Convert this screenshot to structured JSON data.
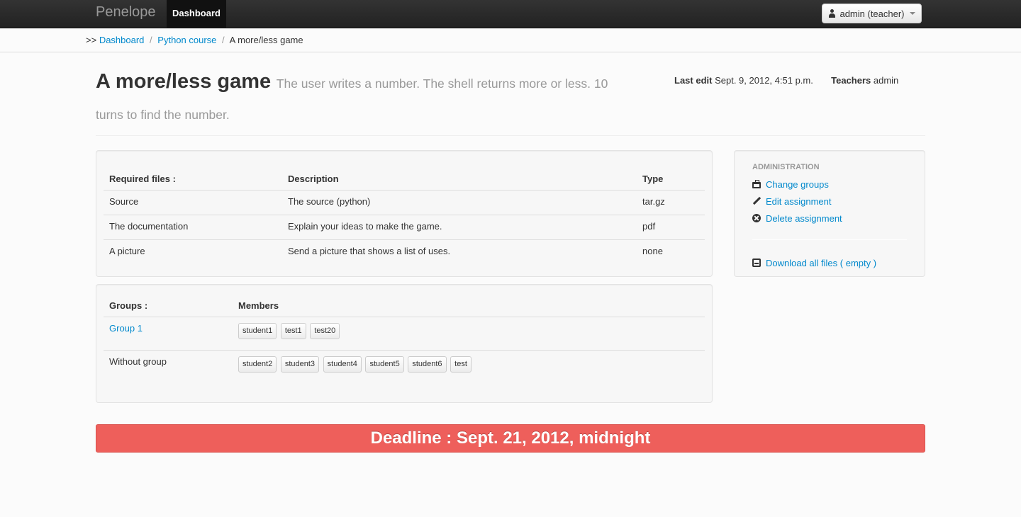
{
  "navbar": {
    "brand": "Penelope",
    "active_item": "Dashboard",
    "user_menu": "admin (teacher)"
  },
  "breadcrumb": {
    "prefix": ">>",
    "items": [
      "Dashboard",
      "Python course"
    ],
    "current": "A more/less game",
    "separator": "/"
  },
  "assignment": {
    "title": "A more/less game",
    "subtitle": "The user writes a number. The shell returns more or less. 10 turns to find the number.",
    "last_edit_label": "Last edit",
    "last_edit_value": "Sept. 9, 2012, 4:51 p.m.",
    "teachers_label": "Teachers",
    "teachers_value": "admin"
  },
  "files_table": {
    "headers": [
      "Required files :",
      "Description",
      "Type"
    ],
    "rows": [
      {
        "name": "Source",
        "description": "The source (python)",
        "type": "tar.gz"
      },
      {
        "name": "The documentation",
        "description": "Explain your ideas to make the game.",
        "type": "pdf"
      },
      {
        "name": "A picture",
        "description": "Send a picture that shows a list of uses.",
        "type": "none"
      }
    ]
  },
  "groups_table": {
    "headers": [
      "Groups :",
      "Members"
    ],
    "rows": [
      {
        "group": "Group 1",
        "members": [
          "student1",
          "test1",
          "test20"
        ]
      },
      {
        "group": "Without group",
        "members": [
          "student2",
          "student3",
          "student4",
          "student5",
          "student6",
          "test"
        ]
      }
    ]
  },
  "admin": {
    "header": "ADMINISTRATION",
    "links": [
      {
        "label": "Change groups",
        "icon": "briefcase-icon"
      },
      {
        "label": "Edit assignment",
        "icon": "pencil-icon"
      },
      {
        "label": "Delete assignment",
        "icon": "remove-circle-icon"
      }
    ],
    "download": {
      "label": "Download all files ( empty )",
      "icon": "inbox-icon"
    }
  },
  "deadline": "Deadline : Sept. 21, 2012, midnight",
  "colors": {
    "link": "#0088cc",
    "deadline_bg": "#ee5f5b",
    "navbar_bg": "#222222"
  }
}
